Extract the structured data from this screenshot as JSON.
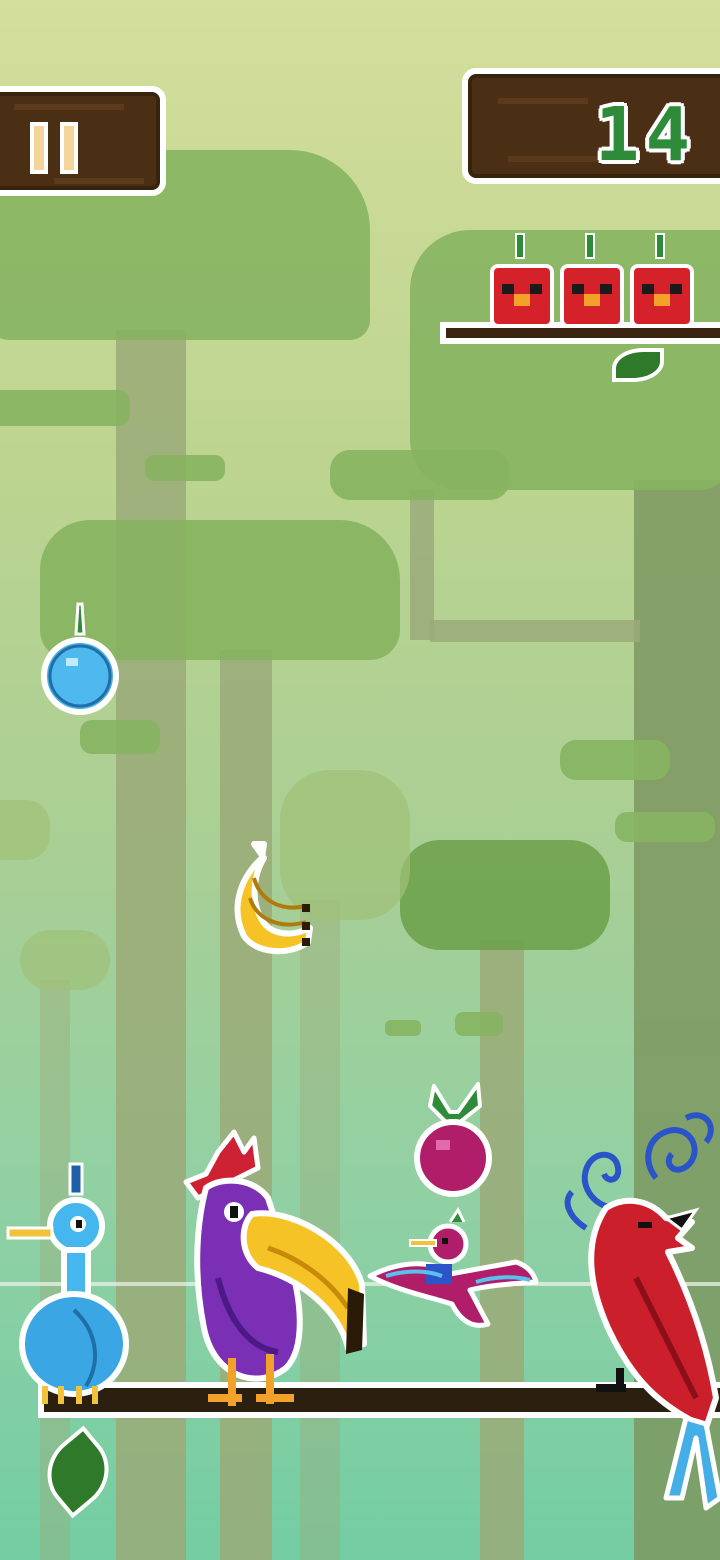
{
  "hud": {
    "score": "14",
    "lives": 3,
    "pause_icon": "pause-icon"
  },
  "falling_fruits": [
    "blueberry",
    "banana",
    "plum"
  ],
  "birds": [
    "blue-peacock",
    "purple-toucan",
    "pink-hummingbird",
    "red-cardinal"
  ],
  "colors": {
    "score_text": "#2e8b3a",
    "plank": "#4a2f14",
    "sky_top": "#d5de9c",
    "sky_bottom": "#74cda3",
    "life_red": "#d4212a"
  }
}
